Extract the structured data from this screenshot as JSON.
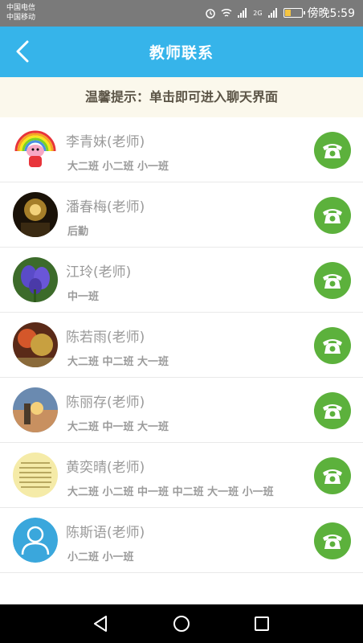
{
  "status_bar": {
    "carrier1": "中国电信",
    "carrier2": "中国移动",
    "time": "傍晚5:59",
    "network": "2G"
  },
  "header": {
    "title": "教师联系"
  },
  "tip": {
    "text": "温馨提示：单击即可进入聊天界面"
  },
  "teachers": [
    {
      "name": "李青妹(老师)",
      "classes": "大二班 小二班 小一班"
    },
    {
      "name": "潘春梅(老师)",
      "classes": "后勤"
    },
    {
      "name": "江玲(老师)",
      "classes": "中一班"
    },
    {
      "name": "陈若雨(老师)",
      "classes": "大二班 中二班 大一班"
    },
    {
      "name": "陈丽存(老师)",
      "classes": "大二班 中一班 大一班"
    },
    {
      "name": "黄奕晴(老师)",
      "classes": "大二班 小二班 中一班 中二班 大一班 小一班"
    },
    {
      "name": "陈斯语(老师)",
      "classes": "小二班 小一班"
    }
  ],
  "colors": {
    "header": "#36b4ea",
    "call_button": "#5cb13c",
    "tip_bg": "#fbf8ec"
  }
}
